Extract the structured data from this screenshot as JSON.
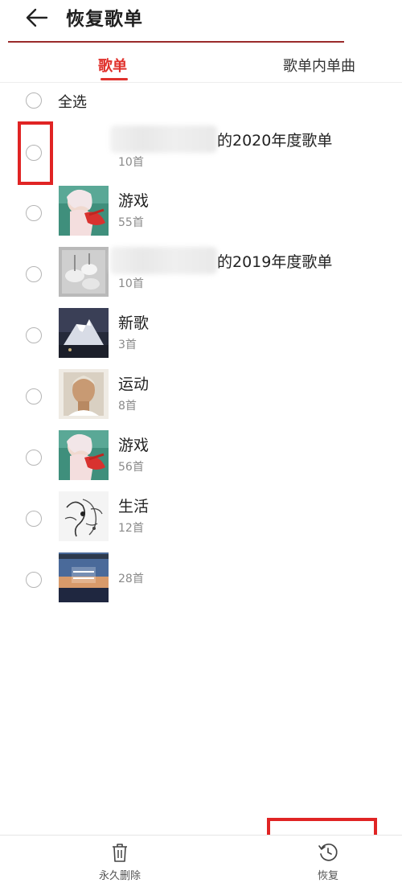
{
  "header": {
    "title": "恢复歌单"
  },
  "tabs": [
    {
      "label": "歌单",
      "active": true
    },
    {
      "label": "歌单内单曲",
      "active": false
    }
  ],
  "select_all": {
    "label": "全选"
  },
  "playlists": [
    {
      "name": "的2020年度歌单",
      "count": "10首",
      "cover": "none",
      "name_blurred_prefix": true
    },
    {
      "name": "游戏",
      "count": "55首",
      "cover": "anime-girl-red"
    },
    {
      "name": "的2019年度歌单",
      "count": "10首",
      "cover": "gray-abstract",
      "name_blurred_prefix": true
    },
    {
      "name": "新歌",
      "count": "3首",
      "cover": "night-mountain"
    },
    {
      "name": "运动",
      "count": "8首",
      "cover": "portrait-man"
    },
    {
      "name": "游戏",
      "count": "56首",
      "cover": "anime-girl-red"
    },
    {
      "name": "生活",
      "count": "12首",
      "cover": "ink-sketch"
    },
    {
      "name": "",
      "count": "28首",
      "cover": "miami-beats"
    }
  ],
  "bottom_bar": {
    "delete_label": "永久删除",
    "restore_label": "恢复"
  },
  "colors": {
    "accent": "#e0312c",
    "highlight": "#e02424"
  }
}
